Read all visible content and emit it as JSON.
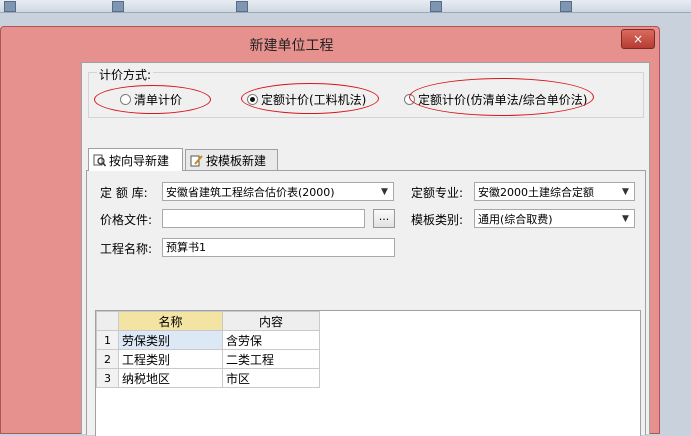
{
  "dialog": {
    "title": "新建单位工程",
    "close_label": "×"
  },
  "pricing": {
    "label": "计价方式:",
    "options": [
      {
        "label": "清单计价",
        "selected": false
      },
      {
        "label": "定额计价(工料机法)",
        "selected": true
      },
      {
        "label": "定额计价(仿清单法/综合单价法)",
        "selected": false
      }
    ]
  },
  "tabs": [
    {
      "label": "按向导新建",
      "icon": "magnifier-document-icon",
      "active": true
    },
    {
      "label": "按模板新建",
      "icon": "edit-document-icon",
      "active": false
    }
  ],
  "form": {
    "quota_lib_label": "定 额 库:",
    "quota_lib_value": "安徽省建筑工程综合估价表(2000)",
    "quota_major_label": "定额专业:",
    "quota_major_value": "安徽2000土建综合定额",
    "price_file_label": "价格文件:",
    "price_file_value": "",
    "browse_label": "...",
    "template_type_label": "模板类别:",
    "template_type_value": "通用(综合取费)",
    "project_name_label": "工程名称:",
    "project_name_value": "预算书1"
  },
  "grid": {
    "headers": [
      "名称",
      "内容"
    ],
    "rows": [
      {
        "no": "1",
        "name": "劳保类别",
        "content": "含劳保"
      },
      {
        "no": "2",
        "name": "工程类别",
        "content": "二类工程"
      },
      {
        "no": "3",
        "name": "纳税地区",
        "content": "市区"
      }
    ]
  },
  "background": {
    "left_items": [
      "额",
      "库"
    ]
  },
  "colors": {
    "title_bar": "#e7918f",
    "annotation": "#d8141b",
    "header_highlight": "#f4e4a3"
  }
}
